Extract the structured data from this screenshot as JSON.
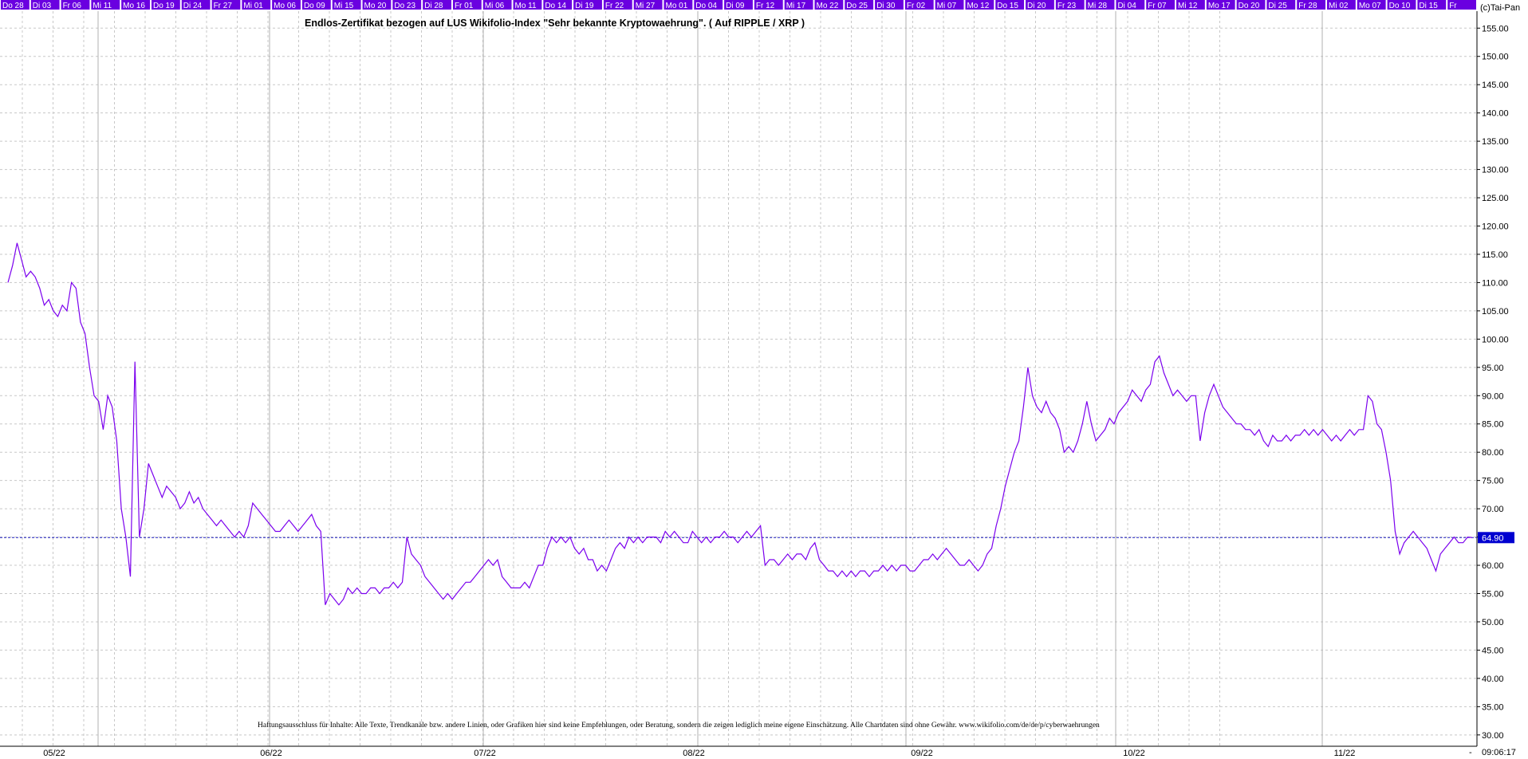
{
  "header": {
    "copyright": "(c)Tai-Pan",
    "date_labels": [
      "Do 28",
      "Di 03",
      "Fr 06",
      "Mi 11",
      "Mo 16",
      "Do 19",
      "Di 24",
      "Fr 27",
      "Mi 01",
      "Mo 06",
      "Do 09",
      "Mi 15",
      "Mo 20",
      "Do 23",
      "Di 28",
      "Fr 01",
      "Mi 06",
      "Mo 11",
      "Do 14",
      "Di 19",
      "Fr 22",
      "Mi 27",
      "Mo 01",
      "Do 04",
      "Di 09",
      "Fr 12",
      "Mi 17",
      "Mo 22",
      "Do 25",
      "Di 30",
      "Fr 02",
      "Mi 07",
      "Mo 12",
      "Do 15",
      "Di 20",
      "Fr 23",
      "Mi 28",
      "Di 04",
      "Fr 07",
      "Mi 12",
      "Mo 17",
      "Do 20",
      "Di 25",
      "Fr 28",
      "Mi 02",
      "Mo 07",
      "Do 10",
      "Di 15",
      "Fr"
    ]
  },
  "footer": {
    "disclaimer": "Haftungsausschluss für Inhalte: Alle Texte, Trendkanäle bzw. andere Linien, oder Grafiken hier sind keine Empfehlungen, oder Beratung, sondern die zeigen lediglich meine eigene Einschätzung. Alle Chartdaten sind ohne Gewähr.  www.wikifolio.com/de/de/p/cyberwaehrungen",
    "time": "09:06:17",
    "dash": "-"
  },
  "colors": {
    "line": "#7b00ee",
    "header_bg": "#6a00e0",
    "header_text": "#ffffff",
    "price_tag_bg": "#0000d0",
    "grid": "#c8c8c8"
  },
  "chart_data": {
    "type": "line",
    "title": "Endlos-Zertifikat bezogen auf LUS Wikifolio-Index \"Sehr bekannte Kryptowaehrung\". ( Auf RIPPLE / XRP )",
    "xlabel": "",
    "ylabel": "",
    "ylim": [
      28,
      158
    ],
    "y_ticks": [
      30,
      35,
      40,
      45,
      50,
      55,
      60,
      65,
      70,
      75,
      80,
      85,
      90,
      95,
      100,
      105,
      110,
      115,
      120,
      125,
      130,
      135,
      140,
      145,
      150,
      155
    ],
    "x_ticks": [
      "05/22",
      "06/22",
      "07/22",
      "08/22",
      "09/22",
      "10/22",
      "11/22"
    ],
    "grid": true,
    "last_price": 64.9,
    "last_price_label": "64.90",
    "points": [
      [
        0,
        110
      ],
      [
        1,
        113
      ],
      [
        2,
        117
      ],
      [
        3,
        114
      ],
      [
        4,
        111
      ],
      [
        5,
        112
      ],
      [
        6,
        111
      ],
      [
        7,
        109
      ],
      [
        8,
        106
      ],
      [
        9,
        107
      ],
      [
        10,
        105
      ],
      [
        11,
        104
      ],
      [
        12,
        106
      ],
      [
        13,
        105
      ],
      [
        14,
        110
      ],
      [
        15,
        109
      ],
      [
        16,
        103
      ],
      [
        17,
        101
      ],
      [
        18,
        95
      ],
      [
        19,
        90
      ],
      [
        20,
        89
      ],
      [
        21,
        84
      ],
      [
        22,
        90
      ],
      [
        23,
        88
      ],
      [
        24,
        82
      ],
      [
        25,
        70
      ],
      [
        26,
        65
      ],
      [
        27,
        58
      ],
      [
        28,
        96
      ],
      [
        29,
        65
      ],
      [
        30,
        70
      ],
      [
        31,
        78
      ],
      [
        32,
        76
      ],
      [
        33,
        74
      ],
      [
        34,
        72
      ],
      [
        35,
        74
      ],
      [
        36,
        73
      ],
      [
        37,
        72
      ],
      [
        38,
        70
      ],
      [
        39,
        71
      ],
      [
        40,
        73
      ],
      [
        41,
        71
      ],
      [
        42,
        72
      ],
      [
        43,
        70
      ],
      [
        44,
        69
      ],
      [
        45,
        68
      ],
      [
        46,
        67
      ],
      [
        47,
        68
      ],
      [
        48,
        67
      ],
      [
        49,
        66
      ],
      [
        50,
        65
      ],
      [
        51,
        66
      ],
      [
        52,
        65
      ],
      [
        53,
        67
      ],
      [
        54,
        71
      ],
      [
        55,
        70
      ],
      [
        56,
        69
      ],
      [
        57,
        68
      ],
      [
        58,
        67
      ],
      [
        59,
        66
      ],
      [
        60,
        66
      ],
      [
        61,
        67
      ],
      [
        62,
        68
      ],
      [
        63,
        67
      ],
      [
        64,
        66
      ],
      [
        65,
        67
      ],
      [
        66,
        68
      ],
      [
        67,
        69
      ],
      [
        68,
        67
      ],
      [
        69,
        66
      ],
      [
        70,
        53
      ],
      [
        71,
        55
      ],
      [
        72,
        54
      ],
      [
        73,
        53
      ],
      [
        74,
        54
      ],
      [
        75,
        56
      ],
      [
        76,
        55
      ],
      [
        77,
        56
      ],
      [
        78,
        55
      ],
      [
        79,
        55
      ],
      [
        80,
        56
      ],
      [
        81,
        56
      ],
      [
        82,
        55
      ],
      [
        83,
        56
      ],
      [
        84,
        56
      ],
      [
        85,
        57
      ],
      [
        86,
        56
      ],
      [
        87,
        57
      ],
      [
        88,
        65
      ],
      [
        89,
        62
      ],
      [
        90,
        61
      ],
      [
        91,
        60
      ],
      [
        92,
        58
      ],
      [
        93,
        57
      ],
      [
        94,
        56
      ],
      [
        95,
        55
      ],
      [
        96,
        54
      ],
      [
        97,
        55
      ],
      [
        98,
        54
      ],
      [
        99,
        55
      ],
      [
        100,
        56
      ],
      [
        101,
        57
      ],
      [
        102,
        57
      ],
      [
        103,
        58
      ],
      [
        104,
        59
      ],
      [
        105,
        60
      ],
      [
        106,
        61
      ],
      [
        107,
        60
      ],
      [
        108,
        61
      ],
      [
        109,
        58
      ],
      [
        110,
        57
      ],
      [
        111,
        56
      ],
      [
        112,
        56
      ],
      [
        113,
        56
      ],
      [
        114,
        57
      ],
      [
        115,
        56
      ],
      [
        116,
        58
      ],
      [
        117,
        60
      ],
      [
        118,
        60
      ],
      [
        119,
        63
      ],
      [
        120,
        65
      ],
      [
        121,
        64
      ],
      [
        122,
        65
      ],
      [
        123,
        64
      ],
      [
        124,
        65
      ],
      [
        125,
        63
      ],
      [
        126,
        62
      ],
      [
        127,
        63
      ],
      [
        128,
        61
      ],
      [
        129,
        61
      ],
      [
        130,
        59
      ],
      [
        131,
        60
      ],
      [
        132,
        59
      ],
      [
        133,
        61
      ],
      [
        134,
        63
      ],
      [
        135,
        64
      ],
      [
        136,
        63
      ],
      [
        137,
        65
      ],
      [
        138,
        64
      ],
      [
        139,
        65
      ],
      [
        140,
        64
      ],
      [
        141,
        65
      ],
      [
        142,
        65
      ],
      [
        143,
        65
      ],
      [
        144,
        64
      ],
      [
        145,
        66
      ],
      [
        146,
        65
      ],
      [
        147,
        66
      ],
      [
        148,
        65
      ],
      [
        149,
        64
      ],
      [
        150,
        64
      ],
      [
        151,
        66
      ],
      [
        152,
        65
      ],
      [
        153,
        64
      ],
      [
        154,
        65
      ],
      [
        155,
        64
      ],
      [
        156,
        65
      ],
      [
        157,
        65
      ],
      [
        158,
        66
      ],
      [
        159,
        65
      ],
      [
        160,
        65
      ],
      [
        161,
        64
      ],
      [
        162,
        65
      ],
      [
        163,
        66
      ],
      [
        164,
        65
      ],
      [
        165,
        66
      ],
      [
        166,
        67
      ],
      [
        167,
        60
      ],
      [
        168,
        61
      ],
      [
        169,
        61
      ],
      [
        170,
        60
      ],
      [
        171,
        61
      ],
      [
        172,
        62
      ],
      [
        173,
        61
      ],
      [
        174,
        62
      ],
      [
        175,
        62
      ],
      [
        176,
        61
      ],
      [
        177,
        63
      ],
      [
        178,
        64
      ],
      [
        179,
        61
      ],
      [
        180,
        60
      ],
      [
        181,
        59
      ],
      [
        182,
        59
      ],
      [
        183,
        58
      ],
      [
        184,
        59
      ],
      [
        185,
        58
      ],
      [
        186,
        59
      ],
      [
        187,
        58
      ],
      [
        188,
        59
      ],
      [
        189,
        59
      ],
      [
        190,
        58
      ],
      [
        191,
        59
      ],
      [
        192,
        59
      ],
      [
        193,
        60
      ],
      [
        194,
        59
      ],
      [
        195,
        60
      ],
      [
        196,
        59
      ],
      [
        197,
        60
      ],
      [
        198,
        60
      ],
      [
        199,
        59
      ],
      [
        200,
        59
      ],
      [
        201,
        60
      ],
      [
        202,
        61
      ],
      [
        203,
        61
      ],
      [
        204,
        62
      ],
      [
        205,
        61
      ],
      [
        206,
        62
      ],
      [
        207,
        63
      ],
      [
        208,
        62
      ],
      [
        209,
        61
      ],
      [
        210,
        60
      ],
      [
        211,
        60
      ],
      [
        212,
        61
      ],
      [
        213,
        60
      ],
      [
        214,
        59
      ],
      [
        215,
        60
      ],
      [
        216,
        62
      ],
      [
        217,
        63
      ],
      [
        218,
        67
      ],
      [
        219,
        70
      ],
      [
        220,
        74
      ],
      [
        221,
        77
      ],
      [
        222,
        80
      ],
      [
        223,
        82
      ],
      [
        224,
        88
      ],
      [
        225,
        95
      ],
      [
        226,
        90
      ],
      [
        227,
        88
      ],
      [
        228,
        87
      ],
      [
        229,
        89
      ],
      [
        230,
        87
      ],
      [
        231,
        86
      ],
      [
        232,
        84
      ],
      [
        233,
        80
      ],
      [
        234,
        81
      ],
      [
        235,
        80
      ],
      [
        236,
        82
      ],
      [
        237,
        85
      ],
      [
        238,
        89
      ],
      [
        239,
        85
      ],
      [
        240,
        82
      ],
      [
        241,
        83
      ],
      [
        242,
        84
      ],
      [
        243,
        86
      ],
      [
        244,
        85
      ],
      [
        245,
        87
      ],
      [
        246,
        88
      ],
      [
        247,
        89
      ],
      [
        248,
        91
      ],
      [
        249,
        90
      ],
      [
        250,
        89
      ],
      [
        251,
        91
      ],
      [
        252,
        92
      ],
      [
        253,
        96
      ],
      [
        254,
        97
      ],
      [
        255,
        94
      ],
      [
        256,
        92
      ],
      [
        257,
        90
      ],
      [
        258,
        91
      ],
      [
        259,
        90
      ],
      [
        260,
        89
      ],
      [
        261,
        90
      ],
      [
        262,
        90
      ],
      [
        263,
        82
      ],
      [
        264,
        87
      ],
      [
        265,
        90
      ],
      [
        266,
        92
      ],
      [
        267,
        90
      ],
      [
        268,
        88
      ],
      [
        269,
        87
      ],
      [
        270,
        86
      ],
      [
        271,
        85
      ],
      [
        272,
        85
      ],
      [
        273,
        84
      ],
      [
        274,
        84
      ],
      [
        275,
        83
      ],
      [
        276,
        84
      ],
      [
        277,
        82
      ],
      [
        278,
        81
      ],
      [
        279,
        83
      ],
      [
        280,
        82
      ],
      [
        281,
        82
      ],
      [
        282,
        83
      ],
      [
        283,
        82
      ],
      [
        284,
        83
      ],
      [
        285,
        83
      ],
      [
        286,
        84
      ],
      [
        287,
        83
      ],
      [
        288,
        84
      ],
      [
        289,
        83
      ],
      [
        290,
        84
      ],
      [
        291,
        83
      ],
      [
        292,
        82
      ],
      [
        293,
        83
      ],
      [
        294,
        82
      ],
      [
        295,
        83
      ],
      [
        296,
        84
      ],
      [
        297,
        83
      ],
      [
        298,
        84
      ],
      [
        299,
        84
      ],
      [
        300,
        90
      ],
      [
        301,
        89
      ],
      [
        302,
        85
      ],
      [
        303,
        84
      ],
      [
        304,
        80
      ],
      [
        305,
        75
      ],
      [
        306,
        66
      ],
      [
        307,
        62
      ],
      [
        308,
        64
      ],
      [
        309,
        65
      ],
      [
        310,
        66
      ],
      [
        311,
        65
      ],
      [
        312,
        64
      ],
      [
        313,
        63
      ],
      [
        314,
        61
      ],
      [
        315,
        59
      ],
      [
        316,
        62
      ],
      [
        317,
        63
      ],
      [
        318,
        64
      ],
      [
        319,
        65
      ],
      [
        320,
        64
      ],
      [
        321,
        64
      ],
      [
        322,
        65
      ],
      [
        323,
        64.9
      ]
    ]
  }
}
